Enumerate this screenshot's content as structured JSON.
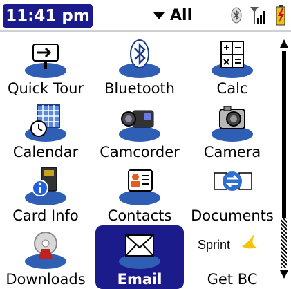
{
  "status": {
    "time": "11:41 pm",
    "category": "All"
  },
  "apps": [
    {
      "label": "Quick Tour",
      "icon": "quick-tour-icon"
    },
    {
      "label": "Bluetooth",
      "icon": "bluetooth-icon"
    },
    {
      "label": "Calc",
      "icon": "calculator-icon"
    },
    {
      "label": "Calendar",
      "icon": "calendar-icon"
    },
    {
      "label": "Camcorder",
      "icon": "camcorder-icon"
    },
    {
      "label": "Camera",
      "icon": "camera-icon"
    },
    {
      "label": "Card Info",
      "icon": "card-info-icon"
    },
    {
      "label": "Contacts",
      "icon": "contacts-icon"
    },
    {
      "label": "Documents",
      "icon": "documents-icon"
    },
    {
      "label": "Downloads",
      "icon": "downloads-icon"
    },
    {
      "label": "Email",
      "icon": "email-icon",
      "selected": true
    },
    {
      "label": "Get BC",
      "icon": "sprint-logo",
      "logo_text": "Sprint"
    }
  ],
  "colors": {
    "highlight": "#1c1b8c",
    "icon_base": "#2f5fb4"
  }
}
